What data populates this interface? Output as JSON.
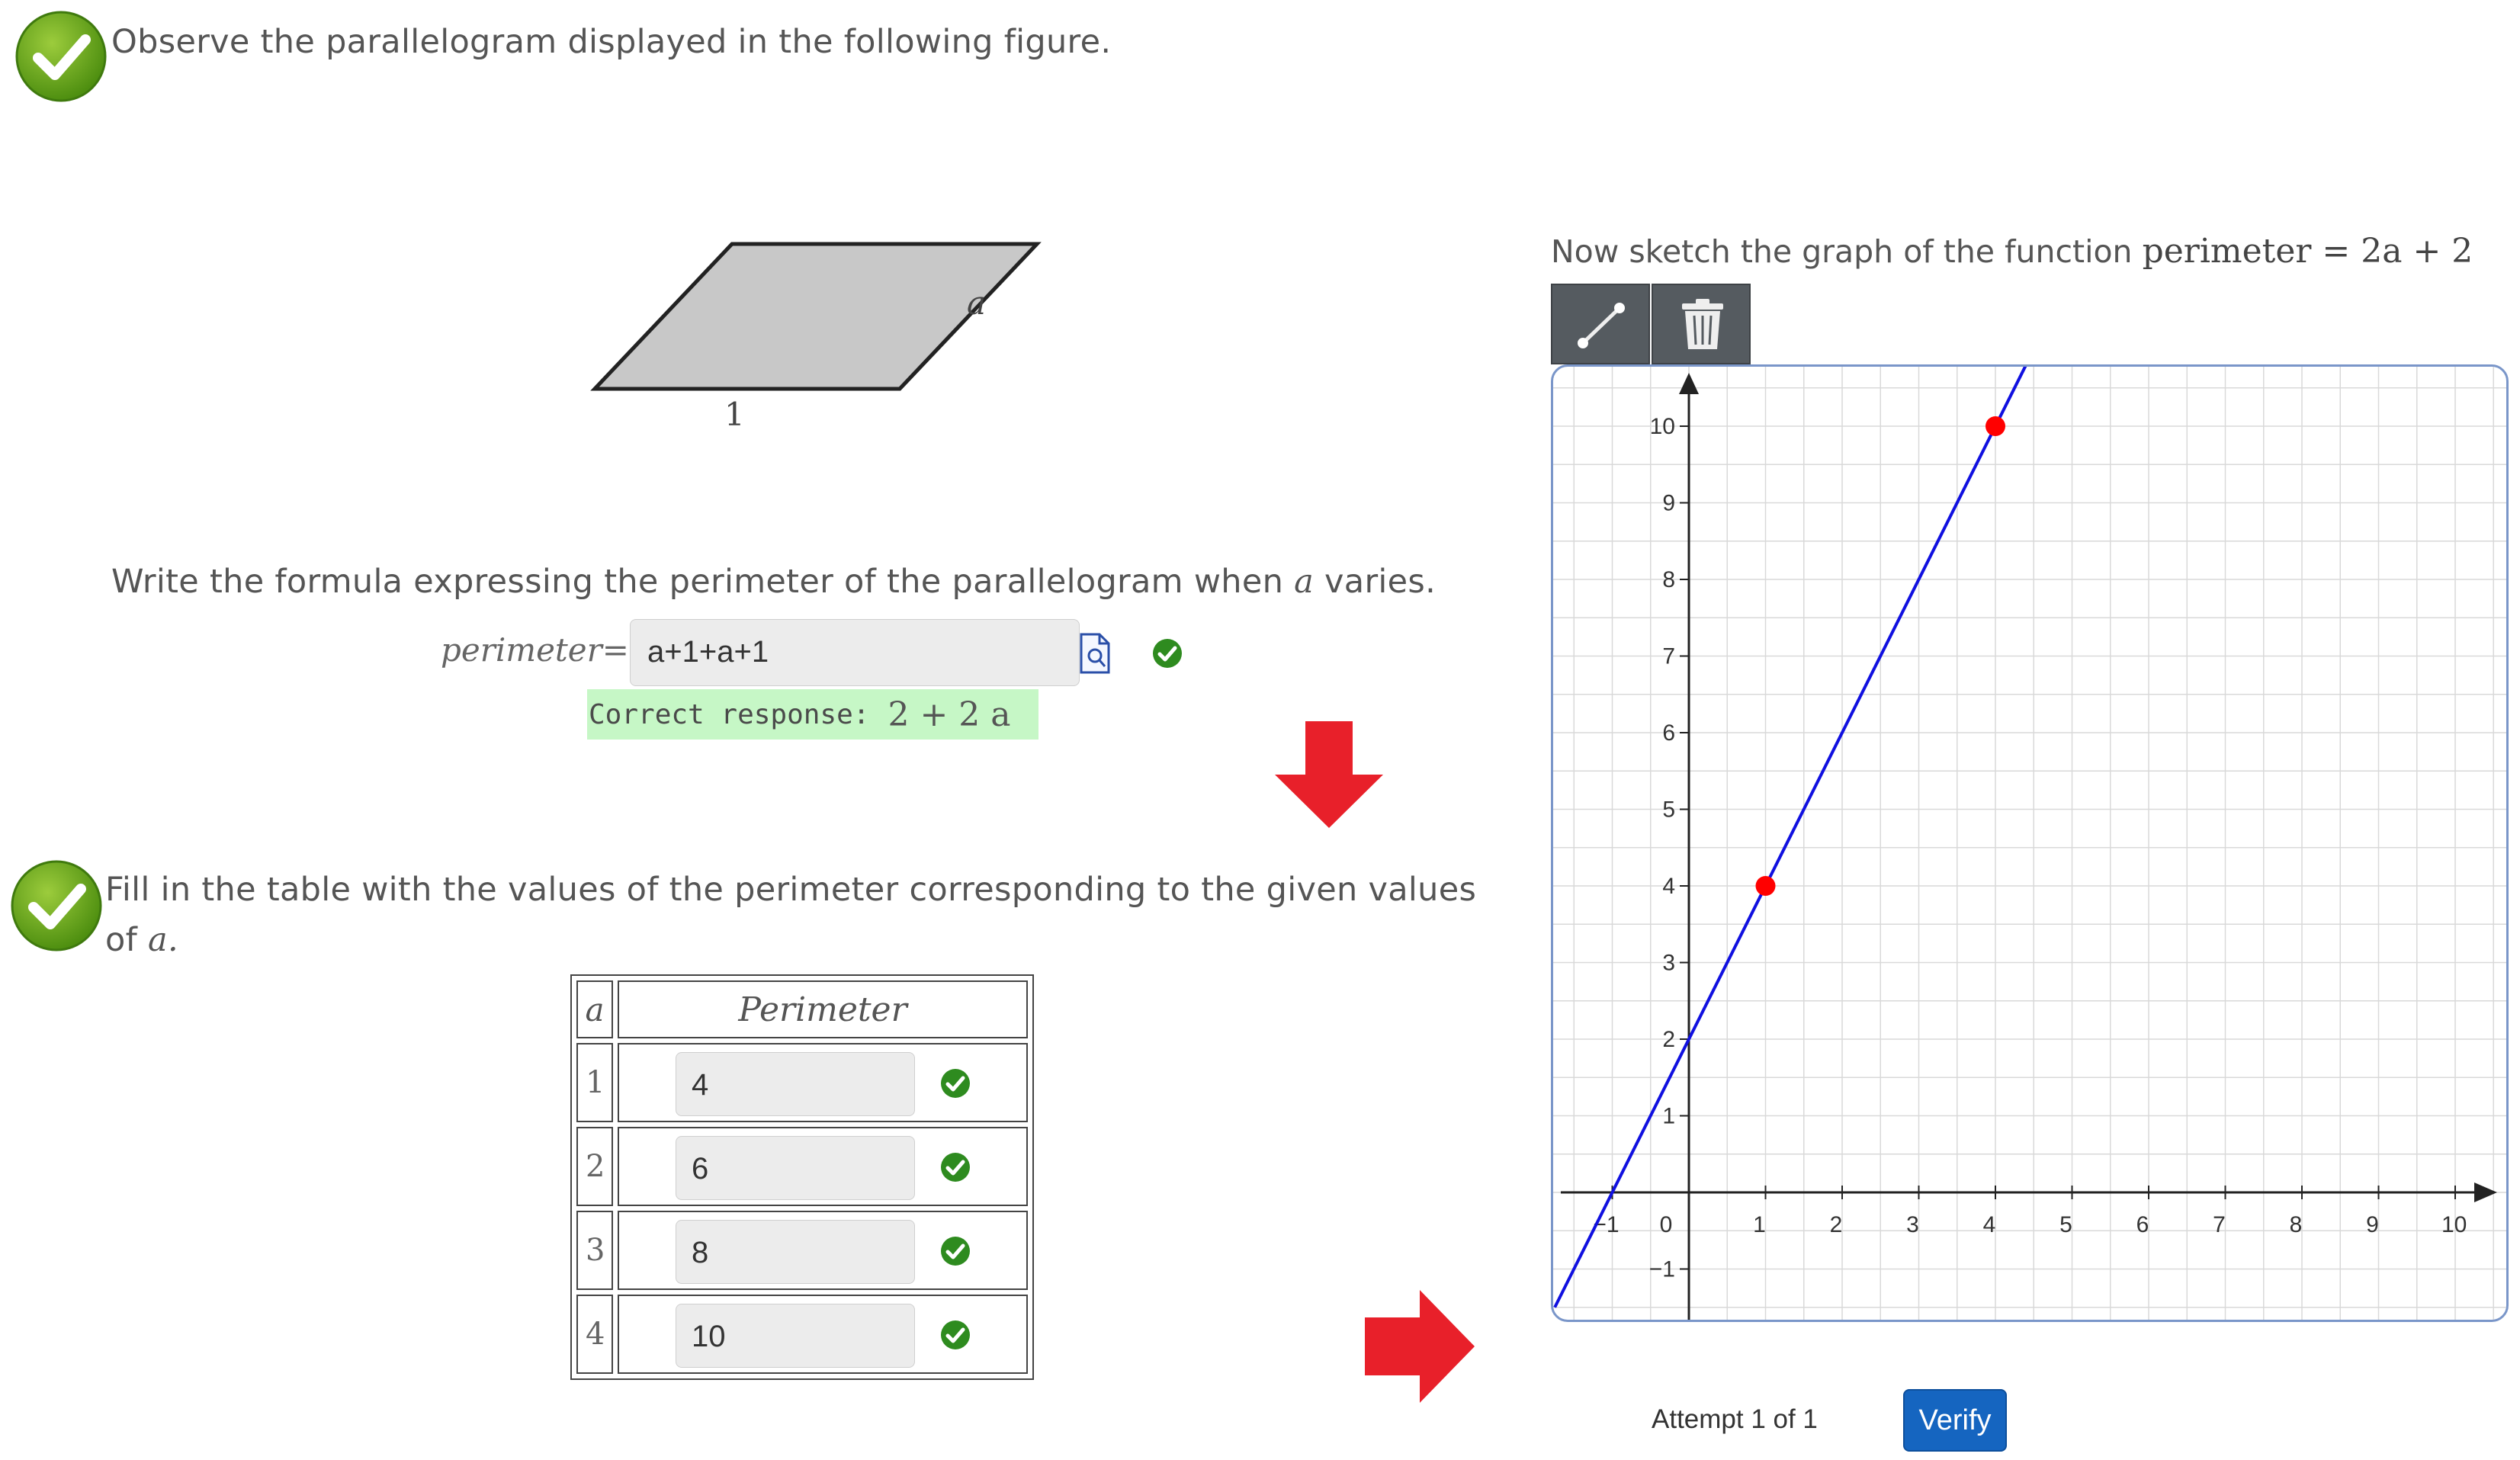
{
  "section1": {
    "status": "correct",
    "prompt": "Observe the parallelogram displayed in the following figure.",
    "figure": {
      "side_bottom_label": "1",
      "side_right_label": "a",
      "fill_color": "#c8c8c8"
    }
  },
  "formula_question": {
    "prompt_part1": "Write the formula expressing the perimeter of the parallelogram when ",
    "prompt_var": "a",
    "prompt_part2": " varies.",
    "label": "perimeter=",
    "input_value": "a+1+a+1",
    "correct_label": "Correct response:",
    "correct_value": "2 + 2 a"
  },
  "section2": {
    "status": "correct",
    "prompt_part1": "Fill in the table with the values of the perimeter corresponding to the given values",
    "prompt_part2": "of ",
    "prompt_var": "a.",
    "table": {
      "headers": [
        "a",
        "Perimeter"
      ],
      "rows": [
        {
          "a": "1",
          "value": "4",
          "status": "correct"
        },
        {
          "a": "2",
          "value": "6",
          "status": "correct"
        },
        {
          "a": "3",
          "value": "8",
          "status": "correct"
        },
        {
          "a": "4",
          "value": "10",
          "status": "correct"
        }
      ]
    }
  },
  "graph_section": {
    "title_text": "Now sketch the graph of the function ",
    "title_math": "perimeter = 2a + 2",
    "toolbar": [
      "line-tool-icon",
      "trash-icon"
    ],
    "attempt_text": "Attempt 1 of 1",
    "verify_label": "Verify"
  },
  "chart_data": {
    "type": "line",
    "xlim": [
      -1,
      10
    ],
    "ylim": [
      -1,
      10
    ],
    "x_ticks": [
      "-1",
      "0",
      "1",
      "2",
      "3",
      "4",
      "5",
      "6",
      "7",
      "8",
      "9",
      "10"
    ],
    "y_ticks": [
      "-1",
      "1",
      "2",
      "3",
      "4",
      "5",
      "6",
      "7",
      "8",
      "9",
      "10"
    ],
    "grid": true,
    "line": {
      "slope": 2,
      "intercept": 2,
      "color": "#1010e0"
    },
    "points": [
      {
        "x": 1,
        "y": 4
      },
      {
        "x": 4,
        "y": 10
      }
    ],
    "point_color": "#ff0000"
  },
  "colors": {
    "correct_green": "#2e8b1f",
    "arrow_red": "#e8202a",
    "verify_blue": "#1565c0",
    "highlight_green": "#c6f7c6"
  }
}
